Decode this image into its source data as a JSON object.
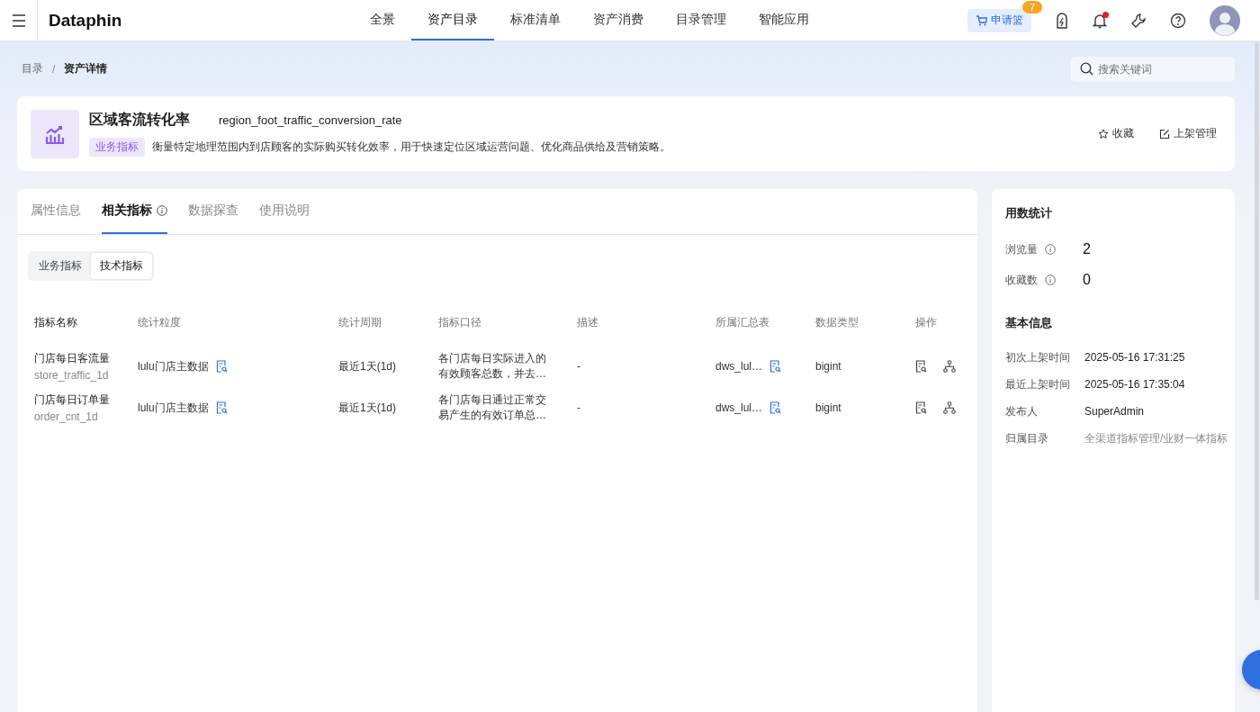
{
  "nav": {
    "logo": "Dataphin",
    "items": [
      {
        "label": "全景",
        "selected": false
      },
      {
        "label": "资产目录",
        "selected": true
      },
      {
        "label": "标准清单",
        "selected": false
      },
      {
        "label": "资产消费",
        "selected": false
      },
      {
        "label": "目录管理",
        "selected": false
      },
      {
        "label": "智能应用",
        "selected": false
      }
    ],
    "cart": {
      "label": "申请篮",
      "badge": "7"
    },
    "unread": true
  },
  "breadcrumb": [
    {
      "label": "目录"
    },
    {
      "label": "资产详情"
    }
  ],
  "breadcrumb_separator": "/",
  "search": {
    "placeholder": "搜索关键词"
  },
  "asset": {
    "name": "区域客流转化率",
    "code": "region_foot_traffic_conversion_rate",
    "tag": "业务指标",
    "description": "衡量特定地理范围内到店顾客的实际购买转化效率，用于快速定位区域运营问题、优化商品供给及营销策略。",
    "actions": [
      {
        "label": "收藏",
        "kind": "star"
      },
      {
        "label": "上架管理",
        "kind": "edit"
      }
    ]
  },
  "tabs": [
    {
      "label": "属性信息",
      "selected": false,
      "info": false
    },
    {
      "label": "相关指标",
      "selected": true,
      "info": true
    },
    {
      "label": "数据探查",
      "selected": false,
      "info": false
    },
    {
      "label": "使用说明",
      "selected": false,
      "info": false
    }
  ],
  "subtabs": [
    {
      "label": "业务指标",
      "selected": false
    },
    {
      "label": "技术指标",
      "selected": true
    }
  ],
  "table": {
    "columns": [
      "指标名称",
      "统计粒度",
      "统计周期",
      "指标口径",
      "描述",
      "所属汇总表",
      "数据类型",
      "操作"
    ],
    "rows": [
      {
        "name": "门店每日客流量",
        "code": "store_traffic_1d",
        "granularity": "lulu门店主数据",
        "period": "最近1天(1d)",
        "definition": "各门店每日实际进入的有效顾客总数，并去…",
        "description": "-",
        "summary_table": "dws_lul…",
        "data_type": "bigint"
      },
      {
        "name": "门店每日订单量",
        "code": "order_cnt_1d",
        "granularity": "lulu门店主数据",
        "period": "最近1天(1d)",
        "definition": "各门店每日通过正常交易产生的有效订单总…",
        "description": "-",
        "summary_table": "dws_lul…",
        "data_type": "bigint"
      }
    ]
  },
  "stats": {
    "title": "用数统计",
    "items": [
      {
        "label": "浏览量",
        "value": "2"
      },
      {
        "label": "收藏数",
        "value": "0"
      }
    ]
  },
  "basic_info": {
    "title": "基本信息",
    "items": [
      {
        "label": "初次上架时间",
        "value": "2025-05-16 17:31:25",
        "kind": "text"
      },
      {
        "label": "最近上架时间",
        "value": "2025-05-16 17:35:04",
        "kind": "text"
      },
      {
        "label": "发布人",
        "value": "SuperAdmin",
        "kind": "text"
      },
      {
        "label": "归属目录",
        "value": "全渠道指标管理/业财一体指标",
        "kind": "path"
      }
    ]
  }
}
